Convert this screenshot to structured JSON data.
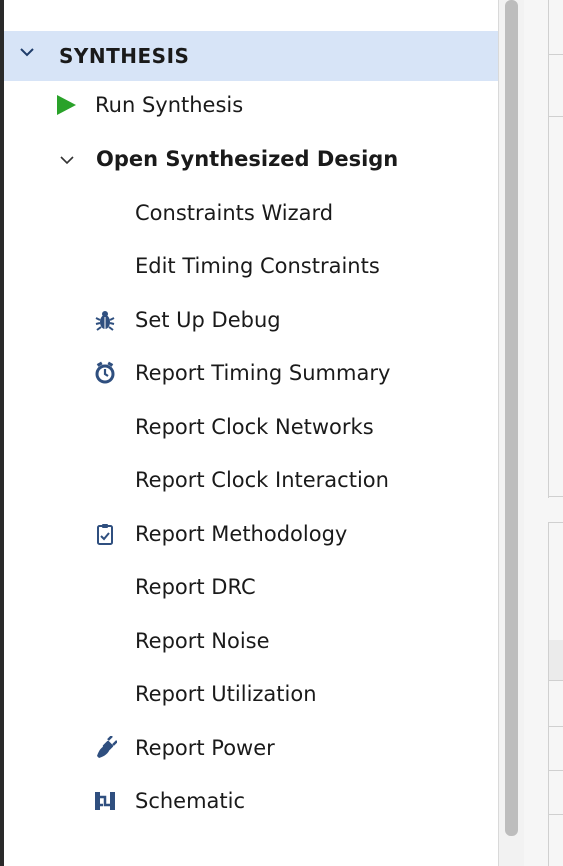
{
  "section": {
    "title": "SYNTHESIS",
    "expanded": true
  },
  "items": [
    {
      "label": "Run Synthesis",
      "icon": "play-icon"
    },
    {
      "label": "Open Synthesized Design",
      "icon": "chevron-down-icon",
      "bold": true
    },
    {
      "label": "Constraints Wizard",
      "icon": ""
    },
    {
      "label": "Edit Timing Constraints",
      "icon": ""
    },
    {
      "label": "Set Up Debug",
      "icon": "bug-icon"
    },
    {
      "label": "Report Timing Summary",
      "icon": "stopwatch-icon"
    },
    {
      "label": "Report Clock Networks",
      "icon": ""
    },
    {
      "label": "Report Clock Interaction",
      "icon": ""
    },
    {
      "label": "Report Methodology",
      "icon": "clipboard-check-icon"
    },
    {
      "label": "Report DRC",
      "icon": ""
    },
    {
      "label": "Report Noise",
      "icon": ""
    },
    {
      "label": "Report Utilization",
      "icon": ""
    },
    {
      "label": "Report Power",
      "icon": "power-plug-icon"
    },
    {
      "label": "Schematic",
      "icon": "schematic-icon"
    }
  ],
  "colors": {
    "header_bg": "#d7e4f7",
    "play_green": "#2aa22a",
    "icon_blue": "#2f4f7f"
  }
}
